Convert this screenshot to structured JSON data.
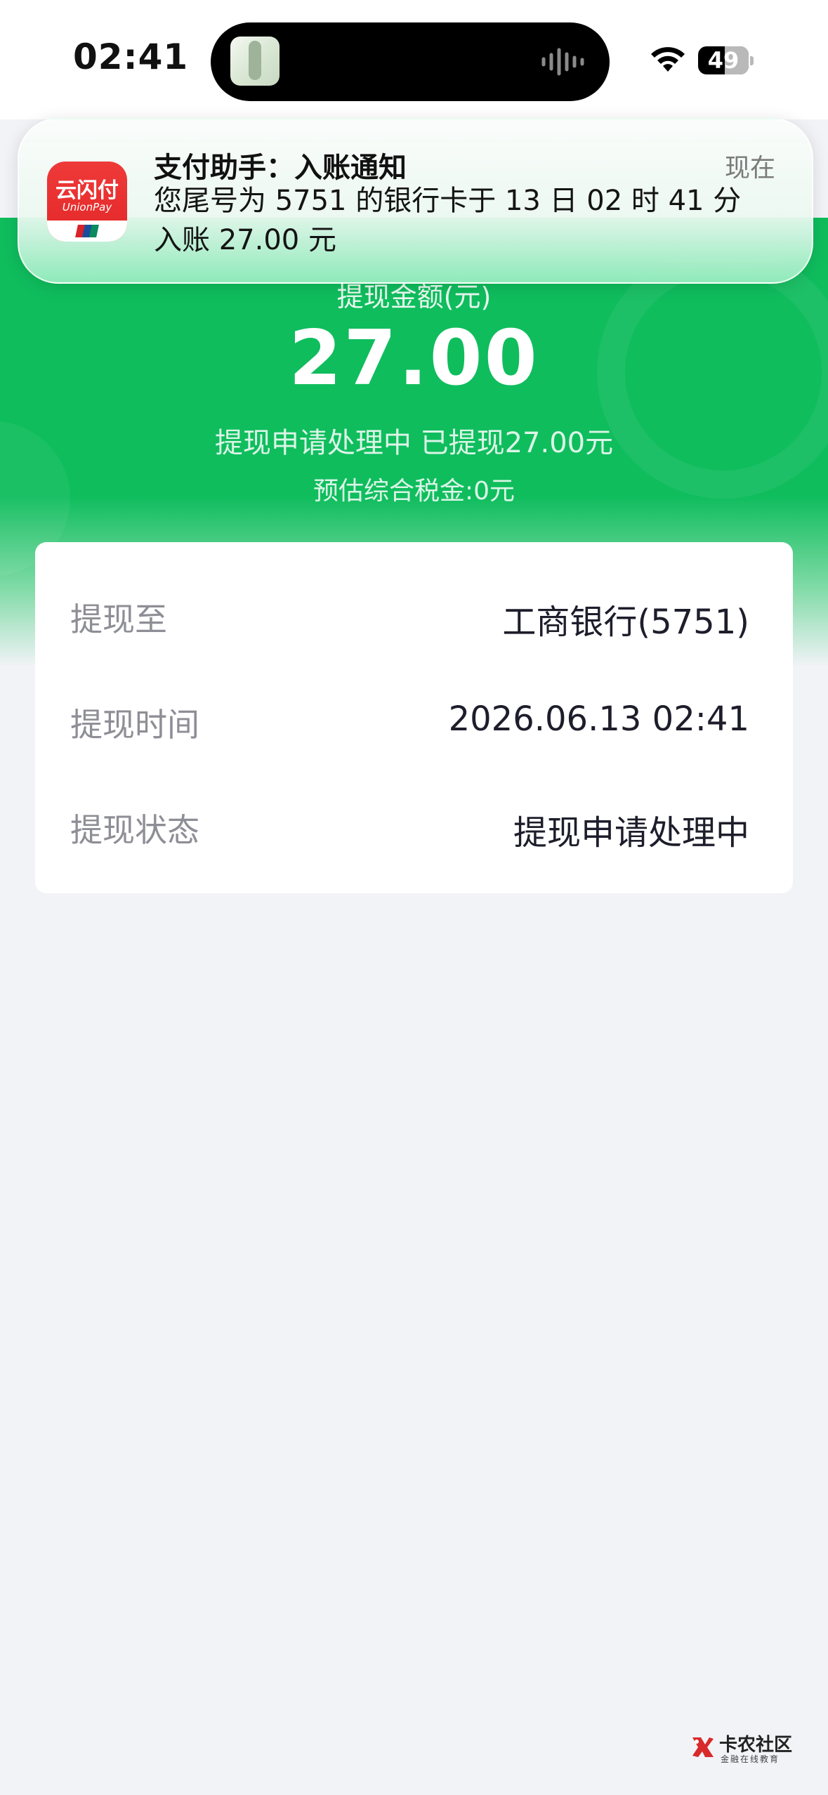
{
  "status_bar": {
    "time": "02:41",
    "battery": "49"
  },
  "notification": {
    "app_name": "云闪付",
    "app_sub": "UnionPay",
    "title": "支付助手：入账通知",
    "time": "现在",
    "body_line1": "您尾号为 5751 的银行卡于 13 日 02 时 41 分",
    "body_line2": "入账 27.00 元"
  },
  "header": {
    "amount_label": "提现金额(元)",
    "amount": "27.00",
    "status_text": "提现申请处理中 已提现27.00元",
    "tax_text": "预估综合税金:0元",
    "colors": {
      "green": "#0fbd5d"
    }
  },
  "details": {
    "rows": [
      {
        "label": "提现至",
        "value": "工商银行(5751)"
      },
      {
        "label": "提现时间",
        "value": "2026.06.13 02:41"
      },
      {
        "label": "提现状态",
        "value": "提现申请处理中"
      }
    ]
  },
  "watermark": {
    "name": "卡农社区",
    "sub": "金融在线教育"
  }
}
